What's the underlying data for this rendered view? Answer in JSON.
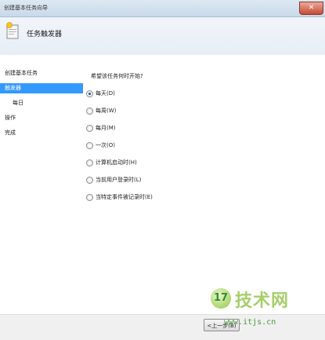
{
  "window": {
    "title": "创建基本任务向导",
    "close_label": "✕"
  },
  "header": {
    "title": "任务触发器"
  },
  "nav": {
    "items": [
      {
        "label": "创建基本任务",
        "active": false,
        "sub": false
      },
      {
        "label": "触发器",
        "active": true,
        "sub": false
      },
      {
        "label": "每日",
        "active": false,
        "sub": true
      },
      {
        "label": "操作",
        "active": false,
        "sub": false
      },
      {
        "label": "完成",
        "active": false,
        "sub": false
      }
    ]
  },
  "main": {
    "question": "希望该任务何时开始?",
    "options": [
      {
        "label": "每天(D)",
        "selected": true
      },
      {
        "label": "每周(W)",
        "selected": false
      },
      {
        "label": "每月(M)",
        "selected": false
      },
      {
        "label": "一次(O)",
        "selected": false
      },
      {
        "label": "计算机启动时(H)",
        "selected": false
      },
      {
        "label": "当前用户登录时(L)",
        "selected": false
      },
      {
        "label": "当特定事件被记录时(E)",
        "selected": false
      }
    ]
  },
  "footer": {
    "back_label": "<上一步(B)"
  },
  "watermark": {
    "logo": "17",
    "text": "技术网",
    "url": "www.itjs.cn"
  },
  "colors": {
    "accent": "#3399ff",
    "radio_dot": "#1c4f9c",
    "watermark": "#a6ce6a"
  }
}
